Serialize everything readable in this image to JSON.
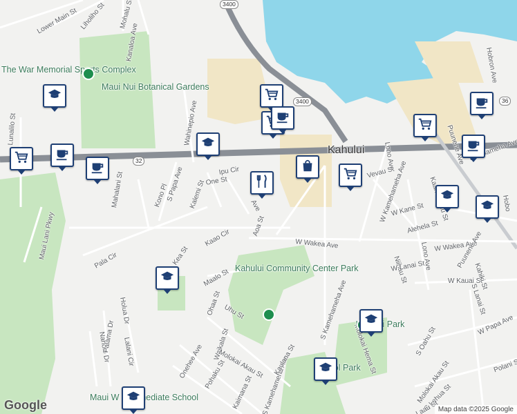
{
  "map": {
    "place_title": "Kahului",
    "attribution": "Map data ©2025 Google",
    "logo": "Google",
    "colors": {
      "water": "#8fd6ea",
      "park": "#c8e6c0",
      "commercial": "#f1e6c6",
      "land": "#f2f2f0",
      "highway": "#8a8f96",
      "pin_border": "#1e3f74"
    }
  },
  "labels": {
    "war_memorial": "The War Memorial Sports Complex",
    "botanical": "Maui Nui Botanical Gardens",
    "community_center": "Kahului Community Center Park",
    "kahului_park": "Kahului Park",
    "school_park_label": "School Park",
    "maui_intermediate": "Maui W Intermediate School",
    "lower_main": "Lower Main St",
    "liholiho": "Liholiho St",
    "mohalu": "Mohalu St",
    "kanaloa": "Kanaloa Ave",
    "wahinepio": "Wahinepio Ave",
    "papa": "S Papa Ave",
    "kono": "Kono Pl",
    "kalemi": "Kalemi St",
    "one": "One St",
    "ipu": "Ipu Cir",
    "mahalani": "Mahalani St",
    "lunalilo": "Lunalilo St",
    "maui_lani": "Maui Lani Pkwy",
    "pala": "Pala Cir",
    "kea": "Kea St",
    "kaao": "Kaao Cir",
    "aoa": "Aoa St",
    "puunene": "Ave",
    "maalo": "Maalo St",
    "ohaa": "Ohaa St",
    "uhu": "Uhu St",
    "nahele": "Naholo Dr",
    "holua": "Holua Dr",
    "lalani": "Lalani Cir",
    "palama": "Palama Dr",
    "onehee": "Onehee Ave",
    "waikala": "Waikala St",
    "pohaku": "Pohaku St",
    "molokai_akau_w": "Molokai Akau St",
    "kaimana": "Kaimana St",
    "kamehameha_s": "S Kamehameha Ave",
    "kamehameha_w": "W Kamehameha Ave",
    "kaulana": "Kaulana St",
    "wakea": "W Wakea Ave",
    "wakea2": "W Wakea Ave",
    "vevau": "Vevau St",
    "kane": "W Kane St",
    "alehela": "Alehela St",
    "lono": "Lono Ave",
    "lono2": "Lono Ave",
    "puunene_ave": "Puunene Ave",
    "puunene_ave2": "Puunene Ave",
    "kamehameha_e": "amehameha Ave",
    "kaahumanu": "Kaahumanu St",
    "niihau": "Niihau St",
    "lanai": "W Lanai St",
    "kauai": "W Kauai St",
    "molokai_hema": "Molokai Hema St",
    "kahiki": "Kahiki St",
    "s_lanai": "S Lanai St",
    "papa_w": "W Papa Ave",
    "oahu": "S Oahu St",
    "molokai_akau_e": "Molokai Akau St",
    "lehua": "S Lehua St",
    "laau": "Laau St",
    "polani": "Polani St",
    "hobron": "Hobron Ave",
    "hobron2": "Hobo",
    "kamehameha_e2": "amehameha Ave"
  },
  "shields": [
    "3400",
    "3400",
    "32",
    "36"
  ],
  "pins": [
    {
      "name": "school",
      "kind": "school-icon"
    },
    {
      "name": "grocery",
      "kind": "grocery-cart-icon"
    },
    {
      "name": "cafe",
      "kind": "coffee-cup-icon"
    },
    {
      "name": "cafe",
      "kind": "coffee-cup-icon"
    },
    {
      "name": "school",
      "kind": "school-icon"
    },
    {
      "name": "grocery",
      "kind": "grocery-cart-icon"
    },
    {
      "name": "grocery",
      "kind": "grocery-cart-icon"
    },
    {
      "name": "cafe",
      "kind": "coffee-cup-icon"
    },
    {
      "name": "shopping",
      "kind": "shopping-bag-icon"
    },
    {
      "name": "restaurant",
      "kind": "restaurant-icon"
    },
    {
      "name": "grocery",
      "kind": "grocery-cart-icon"
    },
    {
      "name": "grocery",
      "kind": "grocery-cart-icon"
    },
    {
      "name": "cafe",
      "kind": "coffee-cup-icon"
    },
    {
      "name": "cafe",
      "kind": "coffee-cup-icon"
    },
    {
      "name": "school",
      "kind": "school-icon"
    },
    {
      "name": "school",
      "kind": "school-icon"
    },
    {
      "name": "school",
      "kind": "school-icon"
    },
    {
      "name": "school",
      "kind": "school-icon"
    },
    {
      "name": "school",
      "kind": "school-icon"
    },
    {
      "name": "school",
      "kind": "school-icon"
    }
  ]
}
